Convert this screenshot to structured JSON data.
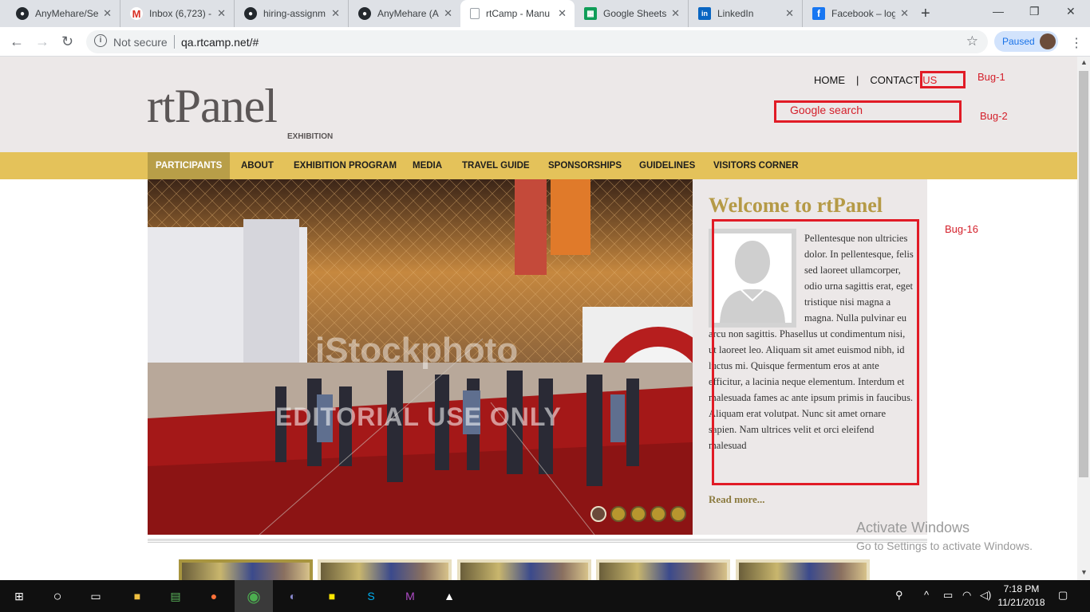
{
  "browser": {
    "tabs": [
      {
        "title": "AnyMehare/Se",
        "icon": "github-icon",
        "color": "#24292e"
      },
      {
        "title": "Inbox (6,723) -",
        "icon": "gmail-icon",
        "color": "#d93025"
      },
      {
        "title": "hiring-assignm",
        "icon": "github-icon",
        "color": "#24292e"
      },
      {
        "title": "AnyMehare (A",
        "icon": "github-icon",
        "color": "#24292e"
      },
      {
        "title": "rtCamp - Manu",
        "icon": "page-icon",
        "color": "#5f6368",
        "active": true
      },
      {
        "title": "Google Sheets",
        "icon": "sheets-icon",
        "color": "#0f9d58"
      },
      {
        "title": "LinkedIn",
        "icon": "linkedin-icon",
        "color": "#0a66c2"
      },
      {
        "title": "Facebook – log",
        "icon": "facebook-icon",
        "color": "#1877f2"
      }
    ],
    "security_label": "Not secure",
    "url": "qa.rtcamp.net/#",
    "profile_label": "Paused"
  },
  "site": {
    "logo": "rtPanel",
    "logo_sub": "EXHIBITION",
    "top_nav": [
      "HOME",
      "|",
      "CONTACT"
    ],
    "top_nav_us": "US",
    "search_label": "Google search",
    "main_nav": [
      "PARTICIPANTS",
      "ABOUT",
      "EXHIBITION PROGRAM",
      "MEDIA",
      "TRAVEL GUIDE",
      "SPONSORSHIPS",
      "GUIDELINES",
      "VISITORS CORNER"
    ],
    "hero_watermark": "iStockphoto",
    "hero_watermark2": "EDITORIAL USE ONLY",
    "slider_dots": 5,
    "welcome_title": "Welcome to rtPanel",
    "welcome_body": "Pellentesque non ultricies dolor. In pellentesque, felis sed laoreet ullamcorper, odio urna sagittis erat, eget tristique nisi magna a magna. Nulla pulvinar eu arcu non sagittis. Phasellus ut condimentum nisi, ut laoreet leo. Aliquam sit amet euismod nibh, id luctus mi. Quisque fermentum eros at ante efficitur, a lacinia neque elementum. Interdum et malesuada fames ac ante ipsum primis in faucibus. Aliquam erat volutpat. Nunc sit amet ornare sapien. Nam ultrices velit et orci eleifend malesuad",
    "read_more": "Read more..."
  },
  "annotations": {
    "bug1": "Bug-1",
    "bug2": "Bug-2",
    "bug16": "Bug-16",
    "color": "#e11b26"
  },
  "watermark": {
    "line1": "Activate Windows",
    "line2": "Go to Settings to activate Windows."
  },
  "taskbar": {
    "time": "7:18 PM",
    "date": "11/21/2018"
  }
}
